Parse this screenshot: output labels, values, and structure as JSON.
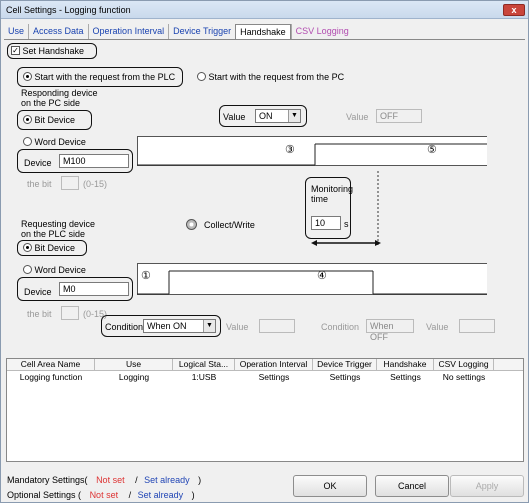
{
  "window": {
    "title": "Cell Settings - Logging function",
    "close": "x"
  },
  "tabs": [
    {
      "label": "Use"
    },
    {
      "label": "Access Data"
    },
    {
      "label": "Operation Interval"
    },
    {
      "label": "Device Trigger"
    },
    {
      "label": "Handshake"
    },
    {
      "label": "CSV Logging"
    }
  ],
  "handshake": {
    "set_label": "Set Handshake",
    "set_checked": true,
    "start_plc": "Start with the request from the PLC",
    "start_pc": "Start with the request from the PC",
    "responding_label_1": "Responding device",
    "responding_label_2": "on the PC side",
    "bit_device": "Bit Device",
    "word_device": "Word Device",
    "device_label": "Device",
    "responding_device": "M100",
    "the_bit": "the bit",
    "range": "(0-15)",
    "value_label": "Value",
    "value": "ON",
    "value2_label": "Value",
    "value2": "OFF",
    "monitoring_time_1": "Monitoring",
    "monitoring_time_2": "time",
    "monitoring_value": "10",
    "monitoring_unit": "s",
    "collect_write": "Collect/Write",
    "requesting_label_1": "Requesting device",
    "requesting_label_2": "on the PLC side",
    "requesting_device": "M0",
    "condition_label": "Condition",
    "condition": "When ON",
    "value3_label": "Value",
    "condition2_label": "Condition",
    "condition2": "When OFF",
    "value4_label": "Value",
    "markers": [
      "③",
      "⑤",
      "①",
      "④"
    ]
  },
  "grid": {
    "headers": [
      "Cell Area Name",
      "Use",
      "Logical Sta...",
      "Operation Interval",
      "Device Trigger",
      "Handshake",
      "CSV Logging"
    ],
    "rows": [
      [
        "Logging function",
        "Logging",
        "1:USB",
        "Settings",
        "Settings",
        "Settings",
        "No settings"
      ]
    ]
  },
  "footer": {
    "mandatory": "Mandatory Settings(",
    "optional": "Optional Settings  (",
    "not_set": "Not set",
    "slash": "/",
    "set_already": "Set already",
    "close_paren": ")",
    "ok": "OK",
    "cancel": "Cancel",
    "apply": "Apply"
  },
  "colors": {
    "link": "#1a43b0",
    "not_set": "#dd3333",
    "set_already": "#2246b5"
  }
}
